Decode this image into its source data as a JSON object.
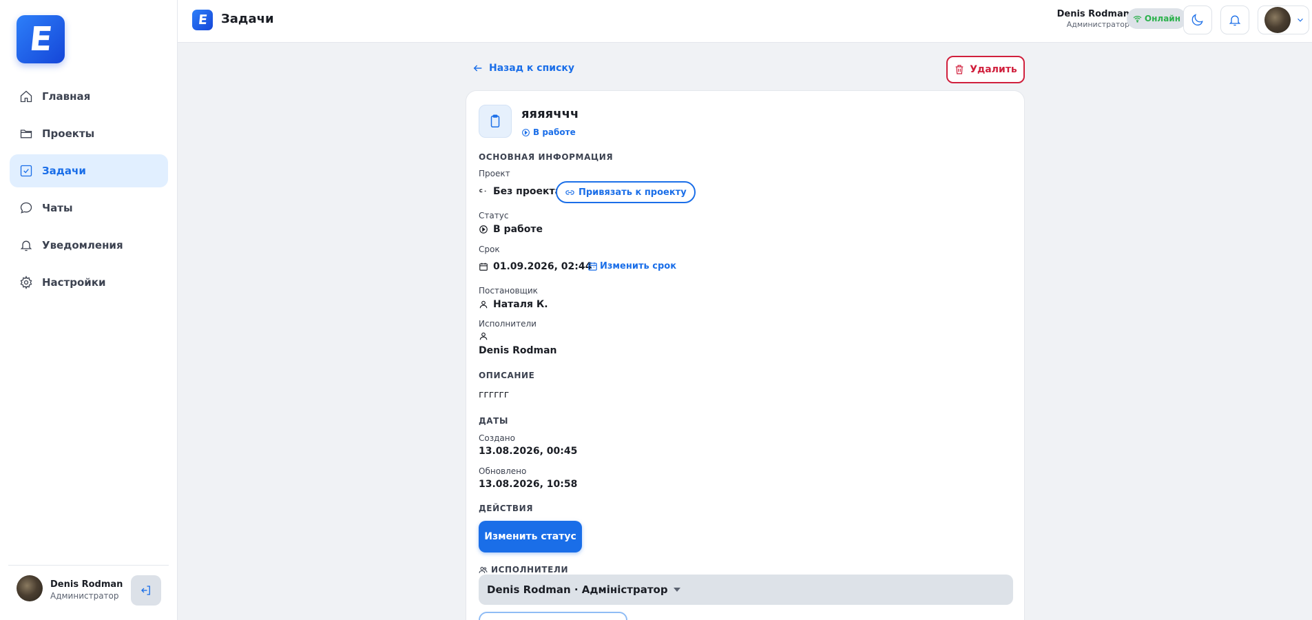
{
  "sidebar": {
    "logo_letter": "E",
    "items": [
      {
        "label": "Главная",
        "icon": "home-icon"
      },
      {
        "label": "Проекты",
        "icon": "folder-icon"
      },
      {
        "label": "Задачи",
        "icon": "checkbox-icon",
        "active": true
      },
      {
        "label": "Чаты",
        "icon": "chat-icon"
      },
      {
        "label": "Уведомления",
        "icon": "bell-icon"
      },
      {
        "label": "Настройки",
        "icon": "gear-icon"
      }
    ],
    "user": {
      "name": "Denis Rodman",
      "role": "Администратор"
    }
  },
  "header": {
    "logo_letter": "E",
    "title": "Задачи",
    "user_name": "Denis Rodman",
    "user_role": "Администратор",
    "online_label": "Онлайн"
  },
  "main": {
    "back_label": "Назад к списку",
    "delete_label": "Удалить"
  },
  "task": {
    "title": "яяяяччч",
    "status_chip": "В работе",
    "sections": {
      "main_info": "Основная информация",
      "description": "Описание",
      "dates": "Даты",
      "actions": "Действия",
      "assignees": "Исполнители"
    },
    "project_label": "Проект",
    "project_value": "Без проекта",
    "bind_project_label": "Привязать к проекту",
    "status_label": "Статус",
    "status_value": "В работе",
    "deadline_label": "Срок",
    "deadline_value": "01.09.2026, 02:44",
    "change_deadline_label": "Изменить срок",
    "author_label": "Постановщик",
    "author_value": "Наталя К.",
    "executors_label": "Исполнители",
    "executors_value": "Denis Rodman",
    "description_text": "гггггг",
    "created_label": "Создано",
    "created_value": "13.08.2026, 00:45",
    "updated_label": "Обновлено",
    "updated_value": "13.08.2026, 10:58",
    "change_status_label": "Изменить статус",
    "assignee_select_value": "Denis Rodman · Адміністратор"
  },
  "colors": {
    "accent": "#1a6ee8",
    "danger": "#d01f3c",
    "online": "#2bb14c",
    "active_nav_bg": "#e1efff"
  }
}
